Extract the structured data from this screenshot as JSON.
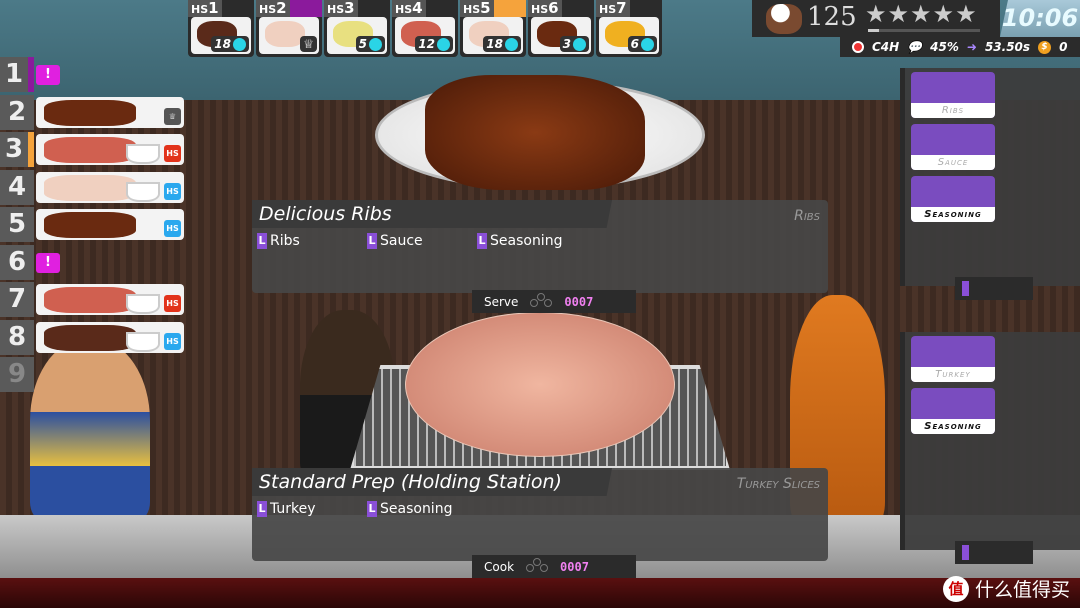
{
  "holding_stations": [
    {
      "label": "HS",
      "num": "1",
      "count": "18",
      "food": "brisket",
      "tag": ""
    },
    {
      "label": "HS",
      "num": "2",
      "count": "",
      "food": "turkey",
      "tag": "#8b1a9c",
      "icon": "chef-hat-icon"
    },
    {
      "label": "HS",
      "num": "3",
      "count": "5",
      "food": "coleslaw",
      "tag": ""
    },
    {
      "label": "HS",
      "num": "4",
      "count": "12",
      "food": "sausage",
      "tag": ""
    },
    {
      "label": "HS",
      "num": "5",
      "count": "18",
      "food": "turkey",
      "tag": "#f5a33c"
    },
    {
      "label": "HS",
      "num": "6",
      "count": "3",
      "food": "ribs",
      "tag": ""
    },
    {
      "label": "HS",
      "num": "7",
      "count": "6",
      "food": "mac-and-cheese",
      "tag": ""
    }
  ],
  "hud": {
    "served": "125",
    "stars": "★★★★★",
    "clock": "10:06",
    "restaurant_code": "C4H",
    "satisfaction": "45%",
    "avg_time": "53.50s",
    "coins": "0"
  },
  "orders": [
    {
      "num": "1",
      "type": "alert",
      "alert": "!",
      "tag": "#8b1a9c"
    },
    {
      "num": "2",
      "food": "ribs",
      "badge": "chef"
    },
    {
      "num": "3",
      "food": "sausage",
      "sauce": true,
      "badge": "HS",
      "badge_color": "#e2331b",
      "tag": "#f5a33c"
    },
    {
      "num": "4",
      "food": "turkey",
      "sauce": true,
      "badge": "HS",
      "badge_color": "#2aa8ee"
    },
    {
      "num": "5",
      "food": "ribs",
      "badge": "HS",
      "badge_color": "#2aa8ee"
    },
    {
      "num": "6",
      "type": "alert",
      "alert": "!"
    },
    {
      "num": "7",
      "food": "sausage",
      "sauce": true,
      "badge": "HS",
      "badge_color": "#e2331b"
    },
    {
      "num": "8",
      "food": "brisket",
      "sauce": true,
      "badge": "HS",
      "badge_color": "#2aa8ee"
    },
    {
      "num": "9",
      "type": "empty"
    }
  ],
  "ribs_panel": {
    "title": "Delicious Ribs",
    "dish": "Ribs",
    "ingredients": [
      "Ribs",
      "Sauce",
      "Seasoning"
    ],
    "key": "L",
    "action": "Serve",
    "code": "0007"
  },
  "turkey_panel": {
    "title": "Standard Prep (Holding Station)",
    "dish": "Turkey Slices",
    "ingredients": [
      "Turkey",
      "Seasoning"
    ],
    "key": "L",
    "action": "Cook",
    "code": "0007"
  },
  "side_ribs": [
    "Ribs",
    "Sauce",
    "Seasoning"
  ],
  "side_turkey": [
    "Turkey",
    "Seasoning"
  ],
  "watermark": {
    "logo": "值",
    "text": "什么值得买"
  },
  "colors": {
    "accent_purple": "#8a4fd8",
    "code_pink": "#f080f0",
    "hs_count_cyan": "#2ad4e6"
  }
}
